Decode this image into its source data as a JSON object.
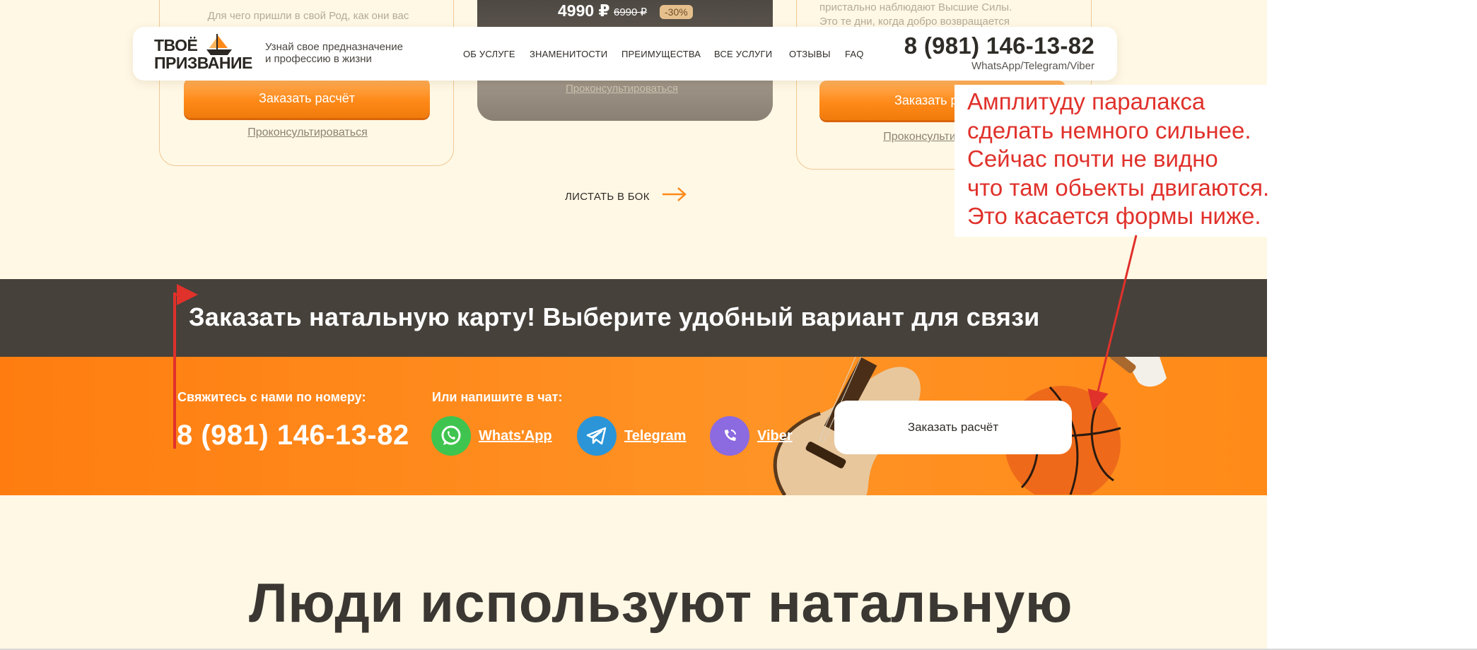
{
  "cards": {
    "left": {
      "text_line": "Для чего пришли в свой Род, как они вас",
      "order_label": "Заказать расчёт",
      "consult_label": "Проконсультироваться"
    },
    "middle": {
      "price": "4990 ₽",
      "old_price": "6990 ₽",
      "discount": "-30%",
      "consult_label": "Проконсультироваться"
    },
    "right": {
      "text_line_1": "пристально наблюдают Высшие Силы.",
      "text_line_2": "Это те дни, когда добро возвращается",
      "order_label": "Заказать расчёт",
      "consult_label": "Проконсультироваться"
    }
  },
  "header": {
    "logo_line1": "ТВОЁ",
    "logo_line2": "ПРИЗВАНИЕ",
    "tagline_line1": "Узнай свое предназначение",
    "tagline_line2": "и профессию в жизни",
    "nav": [
      "ОБ УСЛУГЕ",
      "ЗНАМЕНИТОСТИ",
      "ПРЕИМУЩЕСТВА",
      "ВСЕ УСЛУГИ",
      "ОТЗЫВЫ",
      "FAQ"
    ],
    "phone": "8 (981) 146-13-82",
    "phone_sub": "WhatsApp/Telegram/Viber"
  },
  "scroll_hint": "ЛИСТАТЬ В БОК",
  "contact": {
    "title": "Заказать натальную карту! Выберите удобный вариант для связи",
    "phone_label": "Свяжитесь с нами по номеру:",
    "phone": "8 (981) 146-13-82",
    "chat_label": "Или напишите в чат:",
    "chats": [
      "Whats'App",
      "Telegram",
      "Viber"
    ],
    "order_button": "Заказать расчёт"
  },
  "section_heading": "Люди используют натальную",
  "annotation": {
    "lines": [
      "Амплитуду паралакса",
      "сделать немного сильнее.",
      "Сейчас почти не видно",
      "что там обьекты двигаются.",
      "Это касается формы ниже."
    ]
  },
  "colors": {
    "accent": "#ff8a19",
    "dark": "#46413b",
    "annotation": "#e0312b",
    "background": "#fff8e5"
  }
}
